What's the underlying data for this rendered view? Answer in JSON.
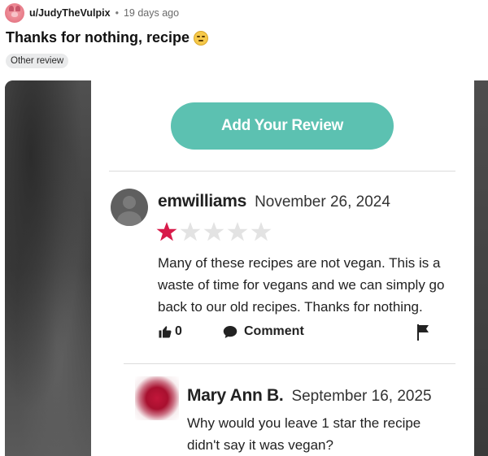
{
  "post": {
    "username": "u/JudyTheVulpix",
    "separator": "•",
    "age": "19 days ago",
    "title": "Thanks for nothing, recipe",
    "flair": "Other review"
  },
  "screenshot": {
    "add_review_label": "Add Your Review",
    "review": {
      "author": "emwilliams",
      "date": "November 26, 2024",
      "rating": 1,
      "max_rating": 5,
      "text": "Many of these recipes are not vegan. This is a waste of time for vegans and we can simply go back to our old recipes. Thanks for nothing.",
      "likes": "0",
      "comment_label": "Comment"
    },
    "reply": {
      "author": "Mary Ann B.",
      "date": "September 16, 2025",
      "text": "Why would you leave 1 star the recipe didn't say it was vegan?"
    }
  },
  "colors": {
    "button": "#5cc1b1",
    "star_filled": "#d81b4a",
    "star_empty": "#e3e3e3"
  }
}
